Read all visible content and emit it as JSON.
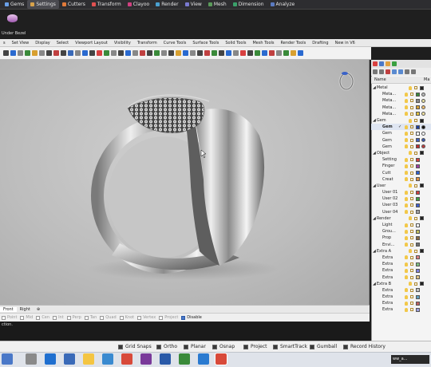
{
  "top_tabs": [
    {
      "label": "Gems",
      "color": "#6aa0e8"
    },
    {
      "label": "Settings",
      "color": "#d7a24a",
      "active": true
    },
    {
      "label": "Cutters",
      "color": "#e07a3a"
    },
    {
      "label": "Transform",
      "color": "#e05050"
    },
    {
      "label": "Clayoo",
      "color": "#d04080"
    },
    {
      "label": "Render",
      "color": "#4aa0d0"
    },
    {
      "label": "View",
      "color": "#7a7ad0"
    },
    {
      "label": "Mesh",
      "color": "#5a9a5a"
    },
    {
      "label": "Dimension",
      "color": "#3aa06a"
    },
    {
      "label": "Analyze",
      "color": "#5a7ac0"
    }
  ],
  "ribbon": {
    "button_label": "Under Bezel"
  },
  "menu_tabs": [
    "s",
    "Set View",
    "Display",
    "Select",
    "Viewport Layout",
    "Visibility",
    "Transform",
    "Curve Tools",
    "Surface Tools",
    "Solid Tools",
    "Mesh Tools",
    "Render Tools",
    "Drafting",
    "New in V6"
  ],
  "viewport_tabs": [
    "Front",
    "Right",
    "⊕"
  ],
  "osnaps": [
    {
      "label": "Point",
      "on": false
    },
    {
      "label": "Mid",
      "on": false
    },
    {
      "label": "Cen",
      "on": false
    },
    {
      "label": "Int",
      "on": false
    },
    {
      "label": "Perp",
      "on": false
    },
    {
      "label": "Tan",
      "on": false
    },
    {
      "label": "Quad",
      "on": false
    },
    {
      "label": "Knot",
      "on": false
    },
    {
      "label": "Vertex",
      "on": false
    },
    {
      "label": "Project",
      "on": false
    },
    {
      "label": "Disable",
      "on": true
    }
  ],
  "command_text": "ction.",
  "status": {
    "grid_snap": "Grid Snaps",
    "ortho": "Ortho",
    "planar": "Planar",
    "osnap": "Osnap",
    "project": "Project",
    "smarttrack": "SmartTrack",
    "gumball": "Gumball",
    "history": "Record History"
  },
  "panel": {
    "col_name": "Name",
    "col_mat": "Ma",
    "layers": [
      {
        "name": "Metal",
        "group": true,
        "swatch": "#222222",
        "mat": null
      },
      {
        "name": "Meta...",
        "swatch": "#3a8a3a",
        "mat": "#bbbbbb"
      },
      {
        "name": "Meta...",
        "swatch": "#888888",
        "mat": "#e8e0a0"
      },
      {
        "name": "Meta...",
        "swatch": "#d8a030",
        "mat": "#f0c070"
      },
      {
        "name": "Meta...",
        "swatch": "#e0c040",
        "mat": "#f4e4a0"
      },
      {
        "name": "Gem",
        "group": true,
        "swatch": "#222222",
        "mat": null
      },
      {
        "name": "Gem",
        "bold": true,
        "check": "✓",
        "swatch": "#2040a0",
        "mat": "#111111"
      },
      {
        "name": "Gem",
        "swatch": "#ffffff",
        "mat": "#ffffff"
      },
      {
        "name": "Gem",
        "swatch": "#4060c0",
        "mat": "#3a5ab0"
      },
      {
        "name": "Gem",
        "swatch": "#c03030",
        "mat": "#c04040"
      },
      {
        "name": "Object",
        "group": true,
        "swatch": "#222222",
        "mat": null
      },
      {
        "name": "Setting",
        "swatch": "#d84040",
        "mat": null
      },
      {
        "name": "Finger",
        "swatch": "#a040a0",
        "mat": null
      },
      {
        "name": "Cutt",
        "swatch": "#3060d0",
        "mat": null
      },
      {
        "name": "Creat",
        "swatch": "#e09040",
        "mat": null
      },
      {
        "name": "User",
        "group": true,
        "swatch": "#222222",
        "mat": null
      },
      {
        "name": "User 01",
        "swatch": "#d04040",
        "mat": null
      },
      {
        "name": "User 02",
        "swatch": "#40a040",
        "mat": null
      },
      {
        "name": "User 03",
        "swatch": "#4060d0",
        "mat": null
      },
      {
        "name": "User 04",
        "swatch": "#a0a0a0",
        "mat": null
      },
      {
        "name": "Render",
        "group": true,
        "swatch": "#222222",
        "mat": null
      },
      {
        "name": "Light",
        "swatch": "#ffffff",
        "mat": null
      },
      {
        "name": "Grou...",
        "swatch": "#c0c060",
        "mat": null
      },
      {
        "name": "Prop",
        "swatch": "#8a6a40",
        "mat": null
      },
      {
        "name": "Envi...",
        "swatch": "#707070",
        "mat": null
      },
      {
        "name": "Extra A",
        "group": true,
        "swatch": "#222222",
        "mat": null
      },
      {
        "name": "Extra",
        "swatch": "#e08080",
        "mat": null
      },
      {
        "name": "Extra",
        "swatch": "#80c080",
        "mat": null
      },
      {
        "name": "Extra",
        "swatch": "#8080e0",
        "mat": null
      },
      {
        "name": "Extra",
        "swatch": "#e0c080",
        "mat": null
      },
      {
        "name": "Extra B",
        "group": true,
        "swatch": "#222222",
        "mat": null
      },
      {
        "name": "Extra",
        "swatch": "#c0c0c0",
        "mat": null
      },
      {
        "name": "Extra",
        "swatch": "#60a0c0",
        "mat": null
      },
      {
        "name": "Extra",
        "swatch": "#c06060",
        "mat": null
      },
      {
        "name": "Extra",
        "swatch": "#a0a0e0",
        "mat": null
      }
    ]
  },
  "taskbar_search": "ww_a..."
}
